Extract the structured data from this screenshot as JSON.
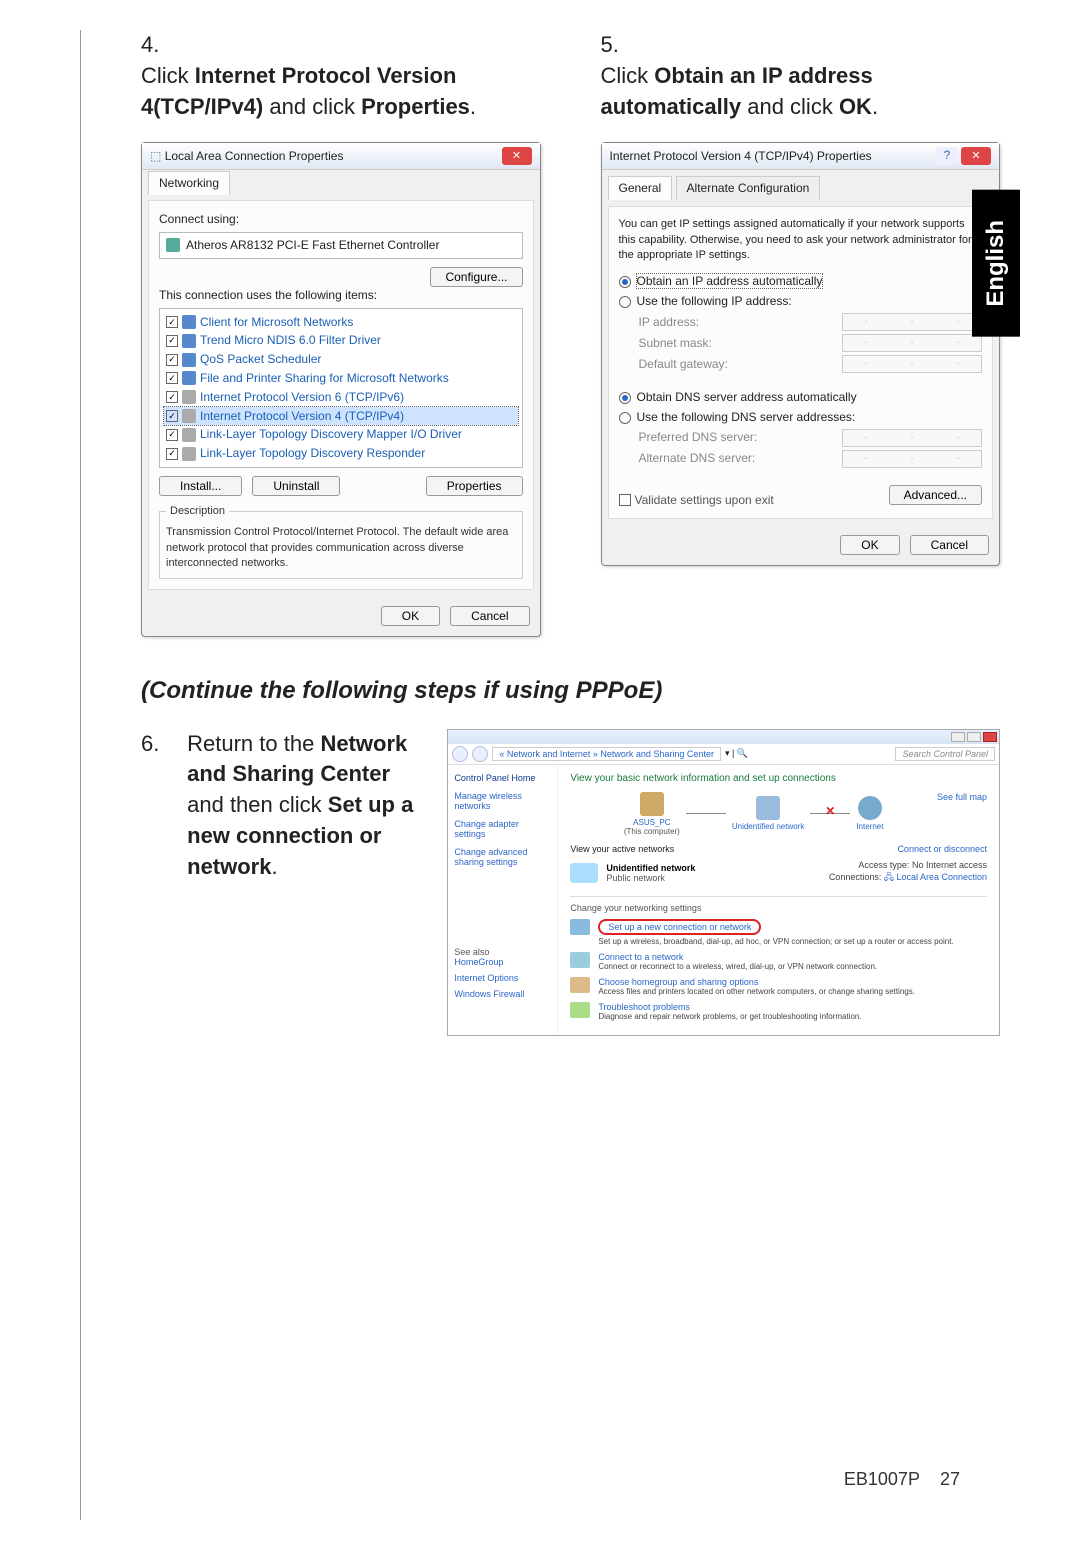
{
  "lang_tab": "English",
  "step4": {
    "num": "4.",
    "t1": "Click ",
    "b1": "Internet Protocol Version 4(TCP/IPv4)",
    "t2": " and click ",
    "b2": "Properties",
    "t3": "."
  },
  "step5": {
    "num": "5.",
    "t1": "Click ",
    "b1": "Obtain an IP address automatically",
    "t2": " and click ",
    "b2": "OK",
    "t3": "."
  },
  "step6": {
    "num": "6.",
    "t1": "Return to the ",
    "b1": "Network and Sharing Center",
    "t2": " and then click ",
    "b2": "Set up a new connection or network",
    "t3": "."
  },
  "sub_heading": "(Continue the following steps if using PPPoE)",
  "dlg1": {
    "title": "Local Area Connection Properties",
    "tab": "Networking",
    "connect_using": "Connect using:",
    "adapter": "Atheros AR8132 PCI-E Fast Ethernet Controller",
    "configure": "Configure...",
    "uses": "This connection uses the following items:",
    "items": [
      "Client for Microsoft Networks",
      "Trend Micro NDIS 6.0 Filter Driver",
      "QoS Packet Scheduler",
      "File and Printer Sharing for Microsoft Networks",
      "Internet Protocol Version 6 (TCP/IPv6)",
      "Internet Protocol Version 4 (TCP/IPv4)",
      "Link-Layer Topology Discovery Mapper I/O Driver",
      "Link-Layer Topology Discovery Responder"
    ],
    "install": "Install...",
    "uninstall": "Uninstall",
    "properties": "Properties",
    "desc_label": "Description",
    "desc": "Transmission Control Protocol/Internet Protocol. The default wide area network protocol that provides communication across diverse interconnected networks.",
    "ok": "OK",
    "cancel": "Cancel"
  },
  "dlg2": {
    "title": "Internet Protocol Version 4 (TCP/IPv4) Properties",
    "tab_general": "General",
    "tab_alt": "Alternate Configuration",
    "info": "You can get IP settings assigned automatically if your network supports this capability. Otherwise, you need to ask your network administrator for the appropriate IP settings.",
    "r1": "Obtain an IP address automatically",
    "r2": "Use the following IP address:",
    "ip": "IP address:",
    "subnet": "Subnet mask:",
    "gateway": "Default gateway:",
    "r3": "Obtain DNS server address automatically",
    "r4": "Use the following DNS server addresses:",
    "pref_dns": "Preferred DNS server:",
    "alt_dns": "Alternate DNS server:",
    "validate": "Validate settings upon exit",
    "advanced": "Advanced...",
    "ok": "OK",
    "cancel": "Cancel"
  },
  "ns": {
    "breadcrumb": "« Network and Internet » Network and Sharing Center",
    "search_decor": "▾ | 🔍",
    "search": "Search Control Panel",
    "side": {
      "home": "Control Panel Home",
      "wireless": "Manage wireless networks",
      "adapter": "Change adapter settings",
      "sharing": "Change advanced sharing settings"
    },
    "see_also_label": "See also",
    "see": {
      "homegroup": "HomeGroup",
      "iopts": "Internet Options",
      "fw": "Windows Firewall"
    },
    "heading": "View your basic network information and set up connections",
    "fullmap": "See full map",
    "node_pc": "ASUS_PC",
    "node_pc_sub": "(This computer)",
    "node_un": "Unidentified network",
    "node_net": "Internet",
    "active_label": "View your active networks",
    "connect_link": "Connect or disconnect",
    "net_name": "Unidentified network",
    "net_type": "Public network",
    "access_type_label": "Access type:",
    "access_type": "No Internet access",
    "connections_label": "Connections:",
    "connections": "Local Area Connection",
    "change_label": "Change your networking settings",
    "opt1_title": "Set up a new connection or network",
    "opt1_desc": "Set up a wireless, broadband, dial-up, ad hoc, or VPN connection; or set up a router or access point.",
    "opt2_title": "Connect to a network",
    "opt2_desc": "Connect or reconnect to a wireless, wired, dial-up, or VPN network connection.",
    "opt3_title": "Choose homegroup and sharing options",
    "opt3_desc": "Access files and printers located on other network computers, or change sharing settings.",
    "opt4_title": "Troubleshoot problems",
    "opt4_desc": "Diagnose and repair network problems, or get troubleshooting information."
  },
  "footer": {
    "model": "EB1007P",
    "page": "27"
  }
}
